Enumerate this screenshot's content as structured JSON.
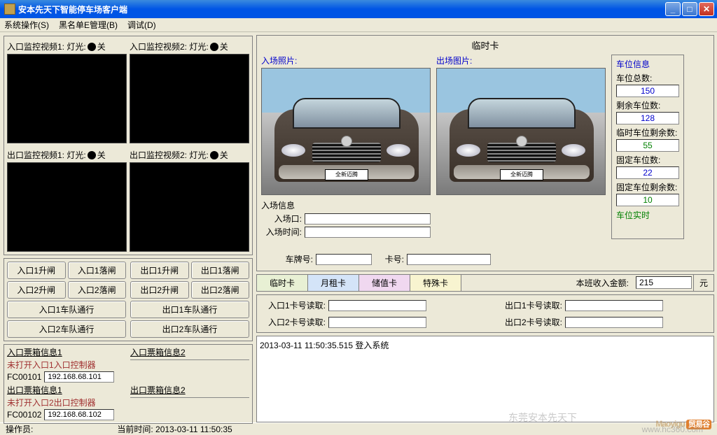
{
  "window": {
    "title": "安本先天下智能停车场客户端"
  },
  "menu": {
    "m1": "系统操作(S)",
    "m2": "黑名单E管理(B)",
    "m3": "调试(D)"
  },
  "videos": {
    "v1": {
      "label_a": "入口监控视频1: 灯光:",
      "label_b": "关"
    },
    "v2": {
      "label_a": "入口监控视频2: 灯光:",
      "label_b": "关"
    },
    "v3": {
      "label_a": "出口监控视频1:  灯光:",
      "label_b": "关"
    },
    "v4": {
      "label_a": "出口监控视频2:  灯光:",
      "label_b": "关"
    }
  },
  "buttons": {
    "l1a": "入口1升闸",
    "l1b": "入口1落闸",
    "l2a": "入口2升闸",
    "l2b": "入口2落闸",
    "l3": "入口1车队通行",
    "l4": "入口2车队通行",
    "r1a": "出口1升闸",
    "r1b": "出口1落闸",
    "r2a": "出口2升闸",
    "r2b": "出口2落闸",
    "r3": "出口1车队通行",
    "r4": "出口2车队通行"
  },
  "tickets": {
    "in1_title": "入口票箱信息1",
    "in1_line": "未打开入口1入口控制器",
    "in1_dev": "FC00101",
    "in1_ip": "192.168.68.101",
    "out1_title": "出口票箱信息1",
    "out1_line": "未打开入口2出口控制器",
    "out1_dev": "FC00102",
    "out1_ip": "192.168.68.102",
    "in2_title": "入口票箱信息2",
    "out2_title": "出口票箱信息2"
  },
  "status": {
    "op": "操作员:",
    "time_lbl": "当前时间:",
    "time": "2013-03-11 11:50:35"
  },
  "card": {
    "title": "临时卡",
    "in_photo": "入场照片:",
    "out_photo": "出场图片:",
    "plate_text": "全新迈腾",
    "entry_grp": "入场信息",
    "entry_gate": "入场口:",
    "entry_time": "入场时间:",
    "car_no": "车牌号:",
    "card_no": "卡号:"
  },
  "lot": {
    "hdr": "车位信息",
    "total_lbl": "车位总数:",
    "total": "150",
    "remain_lbl": "剩余车位数:",
    "remain": "128",
    "temp_remain_lbl": "临时车位剩余数:",
    "temp_remain": "55",
    "fixed_lbl": "固定车位数:",
    "fixed": "22",
    "fixed_remain_lbl": "固定车位剩余数:",
    "fixed_remain": "10",
    "realtime": "车位实时"
  },
  "tabs": {
    "t1": "临时卡",
    "t2": "月租卡",
    "t3": "储值卡",
    "t4": "特殊卡",
    "income_lbl": "本班收入金额:",
    "income": "215",
    "yuan": "元"
  },
  "reads": {
    "in1": "入口1卡号读取:",
    "out1": "出口1卡号读取:",
    "in2": "入口2卡号读取:",
    "out2": "出口2卡号读取:"
  },
  "log": {
    "line1": "2013-03-11 11:50:35.515    登入系统"
  },
  "wm": {
    "brand": "Maoyigu",
    "tag": "贸易谷",
    "url": "www.hc360.com",
    "company": "东莞安本先天下"
  }
}
